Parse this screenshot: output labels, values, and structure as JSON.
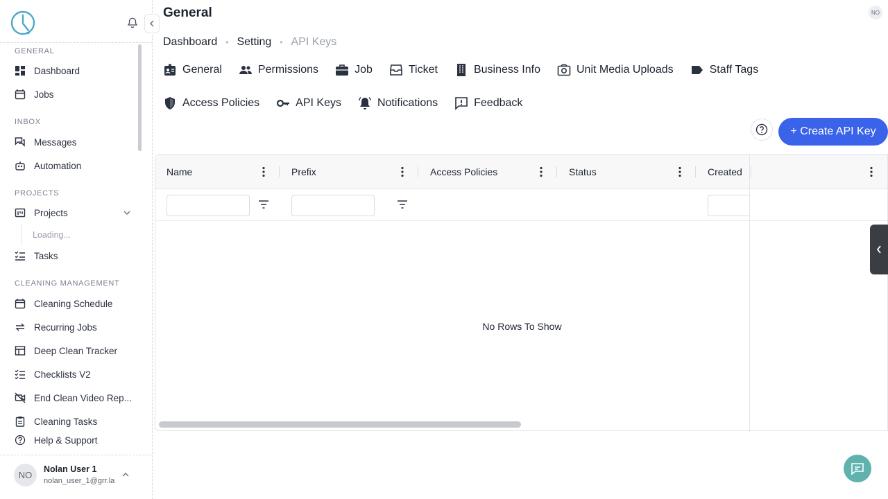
{
  "header": {
    "title": "General",
    "avatar_initials": "NO"
  },
  "breadcrumb": [
    "Dashboard",
    "Setting",
    "API Keys"
  ],
  "tabs_row1": [
    {
      "label": "General",
      "icon": "badge-icon"
    },
    {
      "label": "Permissions",
      "icon": "people-icon"
    },
    {
      "label": "Job",
      "icon": "briefcase-icon"
    },
    {
      "label": "Ticket",
      "icon": "inbox-icon"
    },
    {
      "label": "Business Info",
      "icon": "building-icon"
    },
    {
      "label": "Unit Media Uploads",
      "icon": "camera-icon"
    },
    {
      "label": "Staff Tags",
      "icon": "tag-icon"
    }
  ],
  "tabs_row2": [
    {
      "label": "Access Policies",
      "icon": "shield-icon"
    },
    {
      "label": "API Keys",
      "icon": "key-icon"
    },
    {
      "label": "Notifications",
      "icon": "bell-ring-icon"
    },
    {
      "label": "Feedback",
      "icon": "feedback-icon"
    }
  ],
  "actions": {
    "create_label": "+ Create API Key",
    "accent": "#3b63ea"
  },
  "grid": {
    "columns": [
      "Name",
      "Prefix",
      "Access Policies",
      "Status",
      "Created"
    ],
    "empty_text": "No Rows To Show"
  },
  "sidebar": {
    "sections": {
      "general": "GENERAL",
      "inbox": "INBOX",
      "projects": "PROJECTS",
      "cleaning": "CLEANING MANAGEMENT"
    },
    "items": {
      "dashboard": "Dashboard",
      "jobs": "Jobs",
      "messages": "Messages",
      "automation": "Automation",
      "projects": "Projects",
      "loading": "Loading...",
      "tasks": "Tasks",
      "cleaning_schedule": "Cleaning Schedule",
      "recurring_jobs": "Recurring Jobs",
      "deep_clean": "Deep Clean Tracker",
      "checklists": "Checklists V2",
      "end_clean": "End Clean Video Rep...",
      "cleaning_tasks": "Cleaning Tasks",
      "help": "Help & Support"
    },
    "user": {
      "initials": "NO",
      "name": "Nolan User 1",
      "email": "nolan_user_1@grr.la"
    }
  }
}
